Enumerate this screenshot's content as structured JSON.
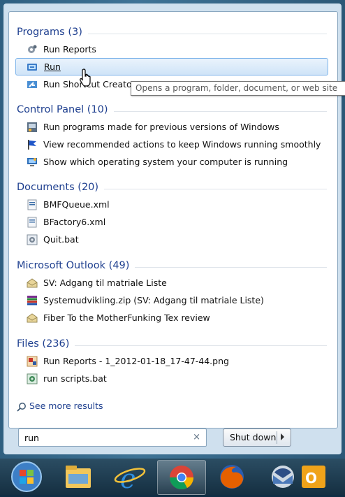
{
  "groups": [
    {
      "title": "Programs (3)",
      "items": [
        {
          "label": "Run Reports",
          "icon": "gear-icon"
        },
        {
          "label": "Run",
          "icon": "run-icon",
          "highlighted": true
        },
        {
          "label": "Run Shortcut Creator",
          "icon": "shortcut-icon"
        }
      ]
    },
    {
      "title": "Control Panel (10)",
      "items": [
        {
          "label": "Run programs made for previous versions of Windows",
          "icon": "compat-icon"
        },
        {
          "label": "View recommended actions to keep Windows running smoothly",
          "icon": "flag-icon"
        },
        {
          "label": "Show which operating system your computer is running",
          "icon": "system-icon"
        }
      ]
    },
    {
      "title": "Documents (20)",
      "items": [
        {
          "label": "BMFQueue.xml",
          "icon": "xml-file-icon"
        },
        {
          "label": "BFactory6.xml",
          "icon": "xml-file-icon"
        },
        {
          "label": "Quit.bat",
          "icon": "bat-file-icon"
        }
      ]
    },
    {
      "title": "Microsoft Outlook (49)",
      "items": [
        {
          "label": "SV: Adgang til matriale Liste",
          "icon": "mail-icon"
        },
        {
          "label": "Systemudvikling.zip (SV: Adgang til matriale Liste)",
          "icon": "zip-icon"
        },
        {
          "label": "Fiber To the MotherFunking Tex review",
          "icon": "mail-icon"
        }
      ]
    },
    {
      "title": "Files (236)",
      "items": [
        {
          "label": "Run Reports - 1_2012-01-18_17-47-44.png",
          "icon": "image-file-icon"
        },
        {
          "label": "run scripts.bat",
          "icon": "bat-file-icon"
        }
      ]
    }
  ],
  "tooltip": "Opens a program, folder, document, or web site",
  "see_more": "See more results",
  "search": {
    "value": "run",
    "clear": "×"
  },
  "shutdown": {
    "label": "Shut down"
  },
  "taskbar": [
    "start-orb-icon",
    "explorer-icon",
    "ie-icon",
    "chrome-icon",
    "firefox-icon",
    "thunderbird-icon",
    "outlook-icon"
  ]
}
